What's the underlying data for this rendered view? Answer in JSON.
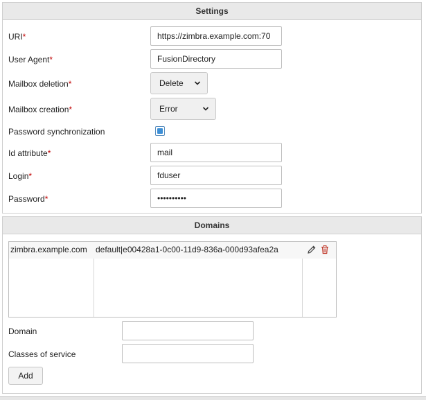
{
  "settings": {
    "title": "Settings",
    "fields": {
      "uri": {
        "label": "URI",
        "required_mark": "*",
        "value": "https://zimbra.example.com:70"
      },
      "user_agent": {
        "label": "User Agent",
        "required_mark": "*",
        "value": "FusionDirectory"
      },
      "mailbox_deletion": {
        "label": "Mailbox deletion",
        "required_mark": "*",
        "value": "Delete"
      },
      "mailbox_creation": {
        "label": "Mailbox creation",
        "required_mark": "*",
        "value": "Error"
      },
      "password_sync": {
        "label": "Password synchronization",
        "checked": true
      },
      "id_attribute": {
        "label": "Id attribute",
        "required_mark": "*",
        "value": "mail"
      },
      "login": {
        "label": "Login",
        "required_mark": "*",
        "value": "fduser"
      },
      "password": {
        "label": "Password",
        "required_mark": "*",
        "value": "••••••••••"
      }
    }
  },
  "domains": {
    "title": "Domains",
    "rows": [
      {
        "domain": "zimbra.example.com",
        "cos": "default|e00428a1-0c00-11d9-836a-000d93afea2a"
      }
    ],
    "domain_field": {
      "label": "Domain",
      "value": ""
    },
    "cos_field": {
      "label": "Classes of service",
      "value": ""
    },
    "add_label": "Add"
  },
  "colors": {
    "required": "#c00000",
    "checkbox_accent": "#3d8fd6",
    "delete_icon": "#c0392b"
  }
}
